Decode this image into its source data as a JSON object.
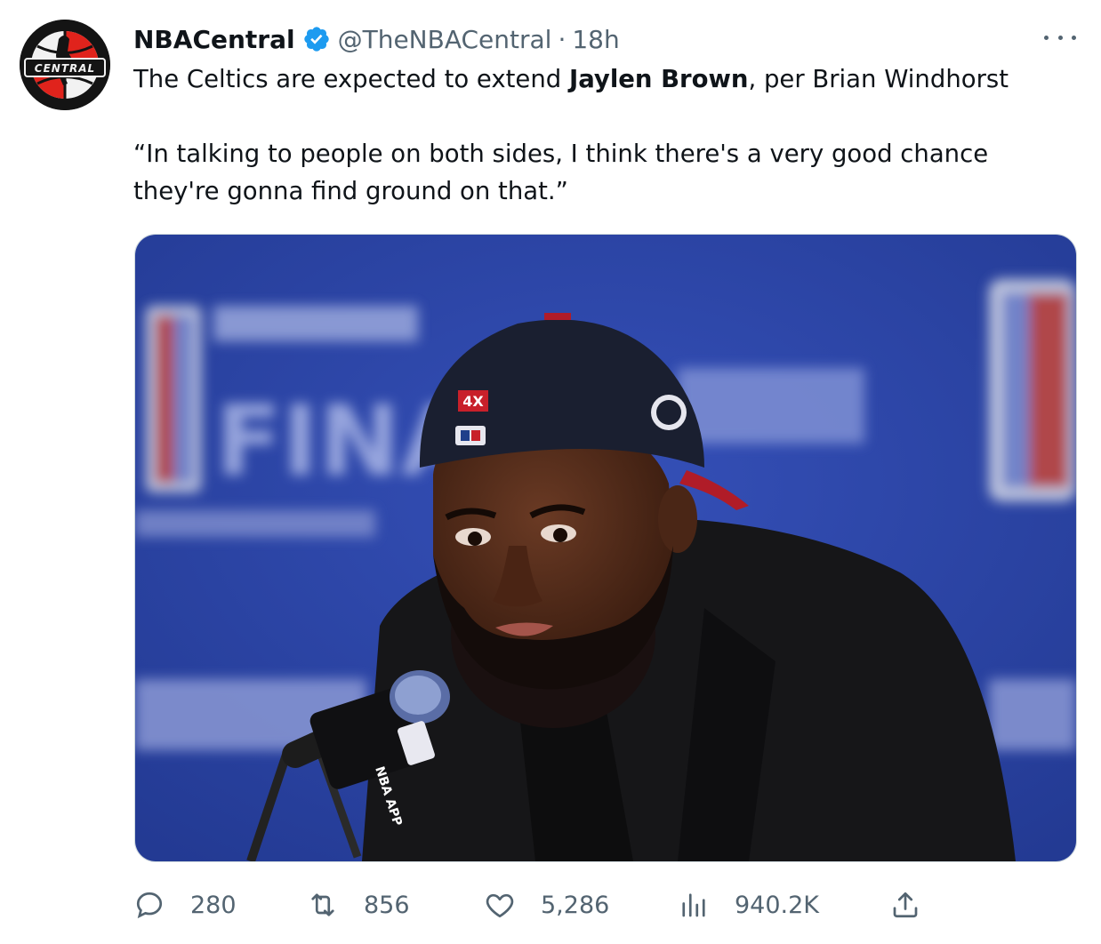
{
  "author": {
    "display_name": "NBACentral",
    "handle": "@TheNBACentral",
    "separator": "·",
    "time": "18h",
    "verified": true,
    "avatar_text": "CENTRAL"
  },
  "tweet": {
    "text_pre": "The Celtics are expected to extend ",
    "text_bold": "Jaylen Brown",
    "text_post": ", per Brian Windhorst",
    "quote": "“In talking to people on both sides, I think there's a very good chance they're gonna find ground on that.”"
  },
  "media": {
    "backdrop_text": "FINALS",
    "cap_text": "4X",
    "mic_label": "NBA APP"
  },
  "actions": {
    "replies": "280",
    "retweets": "856",
    "likes": "5,286",
    "views": "940.2K"
  },
  "colors": {
    "text_primary": "#0f1419",
    "text_secondary": "#536471",
    "verified_blue": "#1d9bf0",
    "backdrop_blue": "#2c45a6"
  },
  "icons": [
    "more-icon",
    "verified-icon",
    "reply-icon",
    "retweet-icon",
    "like-icon",
    "views-icon",
    "share-icon"
  ]
}
